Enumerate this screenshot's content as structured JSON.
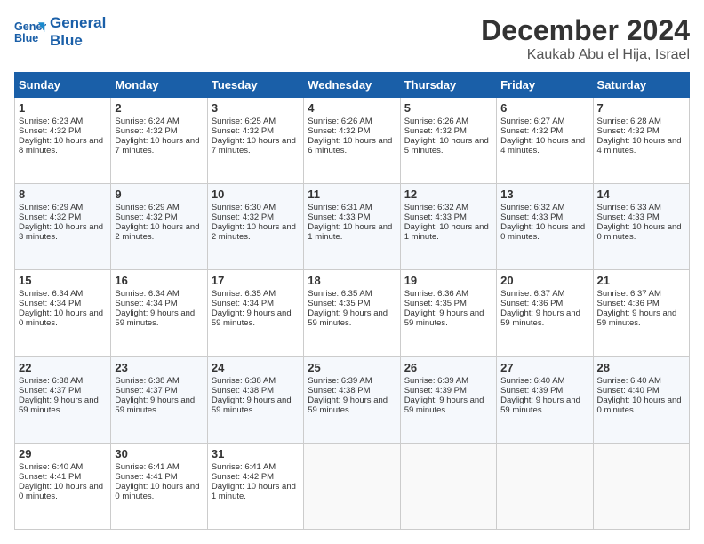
{
  "logo": {
    "line1": "General",
    "line2": "Blue"
  },
  "title": "December 2024",
  "subtitle": "Kaukab Abu el Hija, Israel",
  "days_of_week": [
    "Sunday",
    "Monday",
    "Tuesday",
    "Wednesday",
    "Thursday",
    "Friday",
    "Saturday"
  ],
  "weeks": [
    [
      {
        "day": 1,
        "sunrise": "6:23 AM",
        "sunset": "4:32 PM",
        "daylight": "10 hours and 8 minutes."
      },
      {
        "day": 2,
        "sunrise": "6:24 AM",
        "sunset": "4:32 PM",
        "daylight": "10 hours and 7 minutes."
      },
      {
        "day": 3,
        "sunrise": "6:25 AM",
        "sunset": "4:32 PM",
        "daylight": "10 hours and 7 minutes."
      },
      {
        "day": 4,
        "sunrise": "6:26 AM",
        "sunset": "4:32 PM",
        "daylight": "10 hours and 6 minutes."
      },
      {
        "day": 5,
        "sunrise": "6:26 AM",
        "sunset": "4:32 PM",
        "daylight": "10 hours and 5 minutes."
      },
      {
        "day": 6,
        "sunrise": "6:27 AM",
        "sunset": "4:32 PM",
        "daylight": "10 hours and 4 minutes."
      },
      {
        "day": 7,
        "sunrise": "6:28 AM",
        "sunset": "4:32 PM",
        "daylight": "10 hours and 4 minutes."
      }
    ],
    [
      {
        "day": 8,
        "sunrise": "6:29 AM",
        "sunset": "4:32 PM",
        "daylight": "10 hours and 3 minutes."
      },
      {
        "day": 9,
        "sunrise": "6:29 AM",
        "sunset": "4:32 PM",
        "daylight": "10 hours and 2 minutes."
      },
      {
        "day": 10,
        "sunrise": "6:30 AM",
        "sunset": "4:32 PM",
        "daylight": "10 hours and 2 minutes."
      },
      {
        "day": 11,
        "sunrise": "6:31 AM",
        "sunset": "4:33 PM",
        "daylight": "10 hours and 1 minute."
      },
      {
        "day": 12,
        "sunrise": "6:32 AM",
        "sunset": "4:33 PM",
        "daylight": "10 hours and 1 minute."
      },
      {
        "day": 13,
        "sunrise": "6:32 AM",
        "sunset": "4:33 PM",
        "daylight": "10 hours and 0 minutes."
      },
      {
        "day": 14,
        "sunrise": "6:33 AM",
        "sunset": "4:33 PM",
        "daylight": "10 hours and 0 minutes."
      }
    ],
    [
      {
        "day": 15,
        "sunrise": "6:34 AM",
        "sunset": "4:34 PM",
        "daylight": "10 hours and 0 minutes."
      },
      {
        "day": 16,
        "sunrise": "6:34 AM",
        "sunset": "4:34 PM",
        "daylight": "9 hours and 59 minutes."
      },
      {
        "day": 17,
        "sunrise": "6:35 AM",
        "sunset": "4:34 PM",
        "daylight": "9 hours and 59 minutes."
      },
      {
        "day": 18,
        "sunrise": "6:35 AM",
        "sunset": "4:35 PM",
        "daylight": "9 hours and 59 minutes."
      },
      {
        "day": 19,
        "sunrise": "6:36 AM",
        "sunset": "4:35 PM",
        "daylight": "9 hours and 59 minutes."
      },
      {
        "day": 20,
        "sunrise": "6:37 AM",
        "sunset": "4:36 PM",
        "daylight": "9 hours and 59 minutes."
      },
      {
        "day": 21,
        "sunrise": "6:37 AM",
        "sunset": "4:36 PM",
        "daylight": "9 hours and 59 minutes."
      }
    ],
    [
      {
        "day": 22,
        "sunrise": "6:38 AM",
        "sunset": "4:37 PM",
        "daylight": "9 hours and 59 minutes."
      },
      {
        "day": 23,
        "sunrise": "6:38 AM",
        "sunset": "4:37 PM",
        "daylight": "9 hours and 59 minutes."
      },
      {
        "day": 24,
        "sunrise": "6:38 AM",
        "sunset": "4:38 PM",
        "daylight": "9 hours and 59 minutes."
      },
      {
        "day": 25,
        "sunrise": "6:39 AM",
        "sunset": "4:38 PM",
        "daylight": "9 hours and 59 minutes."
      },
      {
        "day": 26,
        "sunrise": "6:39 AM",
        "sunset": "4:39 PM",
        "daylight": "9 hours and 59 minutes."
      },
      {
        "day": 27,
        "sunrise": "6:40 AM",
        "sunset": "4:39 PM",
        "daylight": "9 hours and 59 minutes."
      },
      {
        "day": 28,
        "sunrise": "6:40 AM",
        "sunset": "4:40 PM",
        "daylight": "10 hours and 0 minutes."
      }
    ],
    [
      {
        "day": 29,
        "sunrise": "6:40 AM",
        "sunset": "4:41 PM",
        "daylight": "10 hours and 0 minutes."
      },
      {
        "day": 30,
        "sunrise": "6:41 AM",
        "sunset": "4:41 PM",
        "daylight": "10 hours and 0 minutes."
      },
      {
        "day": 31,
        "sunrise": "6:41 AM",
        "sunset": "4:42 PM",
        "daylight": "10 hours and 1 minute."
      },
      null,
      null,
      null,
      null
    ]
  ],
  "labels": {
    "sunrise": "Sunrise:",
    "sunset": "Sunset:",
    "daylight": "Daylight:"
  }
}
